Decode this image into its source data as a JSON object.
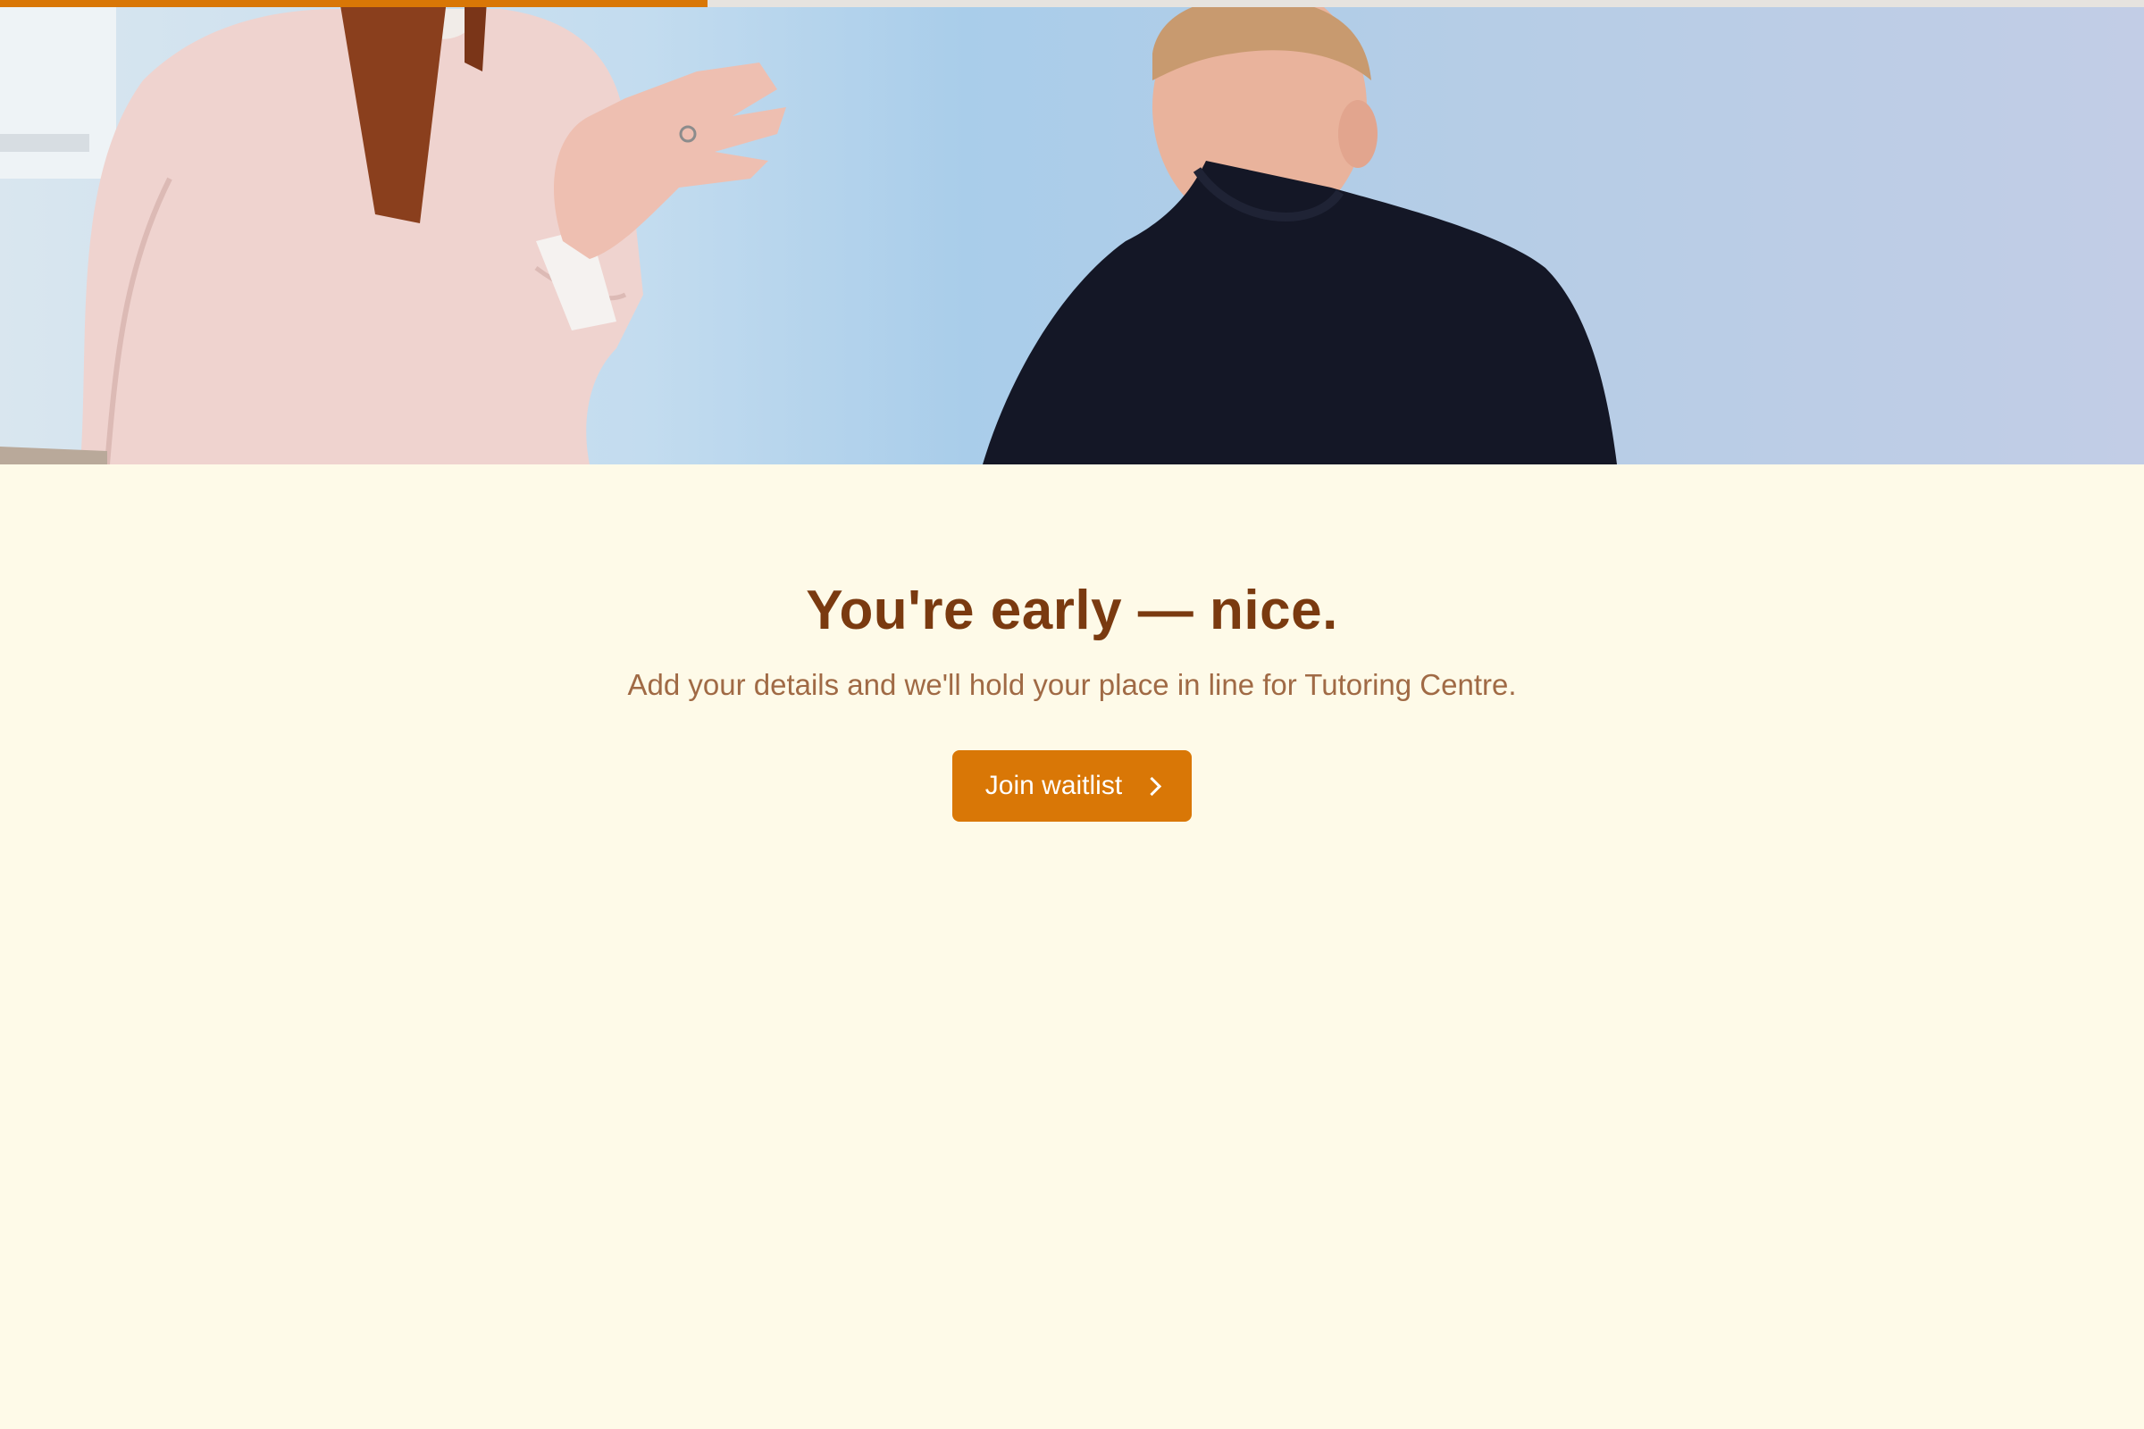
{
  "progress": {
    "value_percent": 33,
    "color": "#d97706"
  },
  "hero": {
    "image": "people-meeting-photo"
  },
  "main": {
    "headline": "You're early — nice.",
    "subline": "Add your details and we'll hold your place in line for Tutoring Centre.",
    "cta_label": "Join waitlist",
    "cta_icon": "chevron-right-icon"
  },
  "colors": {
    "background": "#fefae8",
    "headline": "#7a3a10",
    "subline": "#a06a45",
    "accent": "#d97706"
  }
}
